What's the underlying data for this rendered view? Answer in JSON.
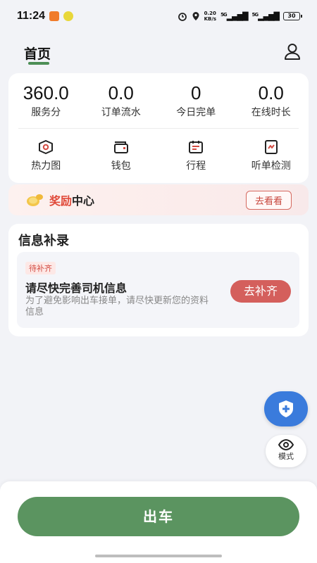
{
  "status_bar": {
    "time": "11:24",
    "net_speed": "0.20\nKB/s",
    "sig1": "5G",
    "sig2": "5G",
    "battery": "30"
  },
  "header": {
    "tab_home": "首页"
  },
  "stats": [
    {
      "value": "360.0",
      "label": "服务分"
    },
    {
      "value": "0.0",
      "label": "订单流水"
    },
    {
      "value": "0",
      "label": "今日完单"
    },
    {
      "value": "0.0",
      "label": "在线时长"
    }
  ],
  "tools": [
    {
      "label": "热力图",
      "icon": "heatmap-icon"
    },
    {
      "label": "钱包",
      "icon": "wallet-icon"
    },
    {
      "label": "行程",
      "icon": "calendar-icon"
    },
    {
      "label": "听单检测",
      "icon": "order-check-icon"
    }
  ],
  "reward": {
    "title_highlight": "奖励",
    "title_rest": "中心",
    "button": "去看看"
  },
  "info": {
    "title": "信息补录",
    "badge": "待补齐",
    "headline": "请尽快完善司机信息",
    "desc": "为了避免影响出车接单，请尽快更新您的资料信息",
    "button": "去补齐"
  },
  "fab": {
    "mode_label": "模式"
  },
  "bottom": {
    "go_button": "出车"
  },
  "colors": {
    "accent_green": "#5b9460",
    "accent_red": "#d45f5c",
    "fab_blue": "#3a7bdc"
  }
}
